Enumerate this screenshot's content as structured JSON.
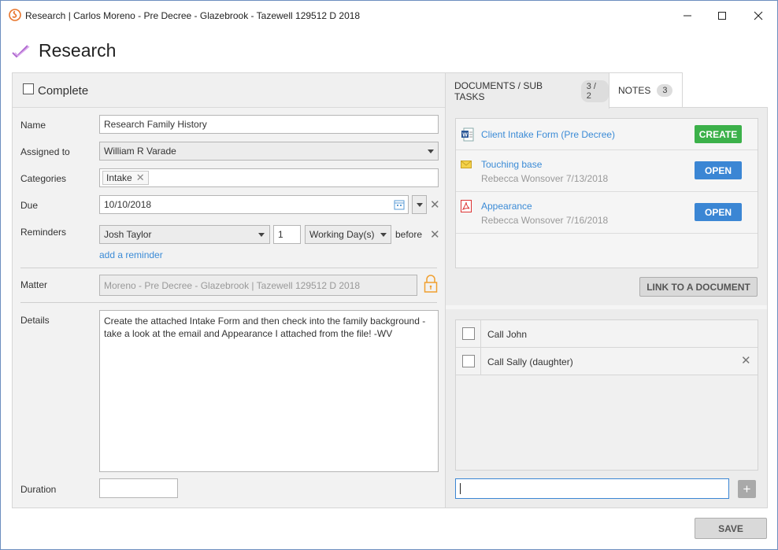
{
  "window": {
    "title": "Research | Carlos Moreno - Pre Decree - Glazebrook - Tazewell 129512 D 2018",
    "minimize_icon": "minimize-icon",
    "maximize_icon": "maximize-icon",
    "close_icon": "close-icon"
  },
  "heading": {
    "title": "Research",
    "icon": "task-check-icon",
    "icon_color": "#b06ad0"
  },
  "complete": {
    "label": "Complete",
    "checked": false
  },
  "form": {
    "name_label": "Name",
    "name_value": "Research Family History",
    "assigned_label": "Assigned to",
    "assigned_value": "William R Varade",
    "categories_label": "Categories",
    "categories": [
      "Intake"
    ],
    "due_label": "Due",
    "due_value": "10/10/2018",
    "reminders_label": "Reminders",
    "reminder_person": "Josh Taylor",
    "reminder_count": "1",
    "reminder_unit": "Working Day(s)",
    "reminder_relation": "before",
    "add_reminder": "add a reminder",
    "matter_label": "Matter",
    "matter_value": "Moreno - Pre Decree - Glazebrook | Tazewell 129512 D 2018",
    "details_label": "Details",
    "details_value": "Create the attached Intake Form and then check into the family background - take a look at the email and Appearance I attached from the file! -WV",
    "duration_label": "Duration",
    "duration_value": ""
  },
  "tabs": [
    {
      "label": "DOCUMENTS / SUB TASKS",
      "count": "3 / 2",
      "active": true
    },
    {
      "label": "NOTES",
      "count": "3",
      "active": false
    }
  ],
  "documents": [
    {
      "title": "Client Intake Form (Pre Decree)",
      "subtitle": "",
      "icon": "word-doc-icon",
      "action": "CREATE"
    },
    {
      "title": "Touching base",
      "subtitle": "Rebecca Wonsover 7/13/2018",
      "icon": "email-icon",
      "action": "OPEN"
    },
    {
      "title": "Appearance",
      "subtitle": "Rebecca Wonsover 7/16/2018",
      "icon": "pdf-icon",
      "action": "OPEN"
    }
  ],
  "link_document": "LINK TO A DOCUMENT",
  "subtasks": [
    {
      "label": "Call John",
      "checked": false
    },
    {
      "label": "Call Sally (daughter)",
      "checked": false
    }
  ],
  "new_subtask": {
    "value": ""
  },
  "save": "SAVE",
  "colors": {
    "accent_blue": "#3b86d4",
    "create_green": "#3cb14a",
    "lock_orange": "#f0a030"
  }
}
